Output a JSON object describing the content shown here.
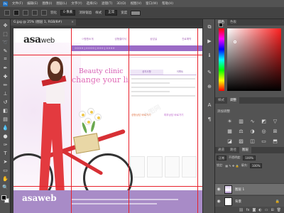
{
  "menubar": {
    "items": [
      "文件(F)",
      "编辑(E)",
      "图像(I)",
      "图层(L)",
      "文字(Y)",
      "选择(S)",
      "滤镜(T)",
      "3D(D)",
      "视图(V)",
      "窗口(W)",
      "帮助(H)"
    ]
  },
  "options": {
    "feather_label": "羽化",
    "feather_value": "0 像素",
    "antialias_label": "消除锯齿",
    "style_label": "样式",
    "style_value": "正常",
    "width_label": "宽度"
  },
  "document": {
    "tab_title": "G.jpg @ 25% (图层 1, RGB/8#)",
    "close": "×"
  },
  "artwork": {
    "logo_main": "asa",
    "logo_web": "web",
    "nav": [
      "ㅇ병원소개",
      "성형클리닉",
      "상담실",
      "진료예약"
    ],
    "subnav": "ㅇㅇㅇㅇ  |  ㅇㅇㅇㅇ  |  ㅇㅇㅇ  |  ㅇㅇㅇㅇ",
    "tagline1": "Beauty clinic",
    "tagline2": "change your life",
    "panel_tabs": [
      "공지사항",
      "이벤트"
    ],
    "section_left": "성형상담 바로가기",
    "section_right": "피부상담 바로가기",
    "footer_logo": "asaweb"
  },
  "right_panels": {
    "color_tabs": [
      "颜色",
      "色板"
    ],
    "adjust_tabs": [
      "样式",
      "调整"
    ],
    "adjust_title": "添加调整",
    "layers_tabs": [
      "通道",
      "路径",
      "图层"
    ],
    "blend_mode": "正常",
    "opacity_label": "不透明度:",
    "opacity_value": "100%",
    "lock_label": "锁定:",
    "fill_label": "填充:",
    "fill_value": "100%",
    "layers": [
      {
        "name": "图层 1",
        "selected": true
      },
      {
        "name": "背景",
        "selected": false
      }
    ]
  },
  "watermark": "大图网"
}
